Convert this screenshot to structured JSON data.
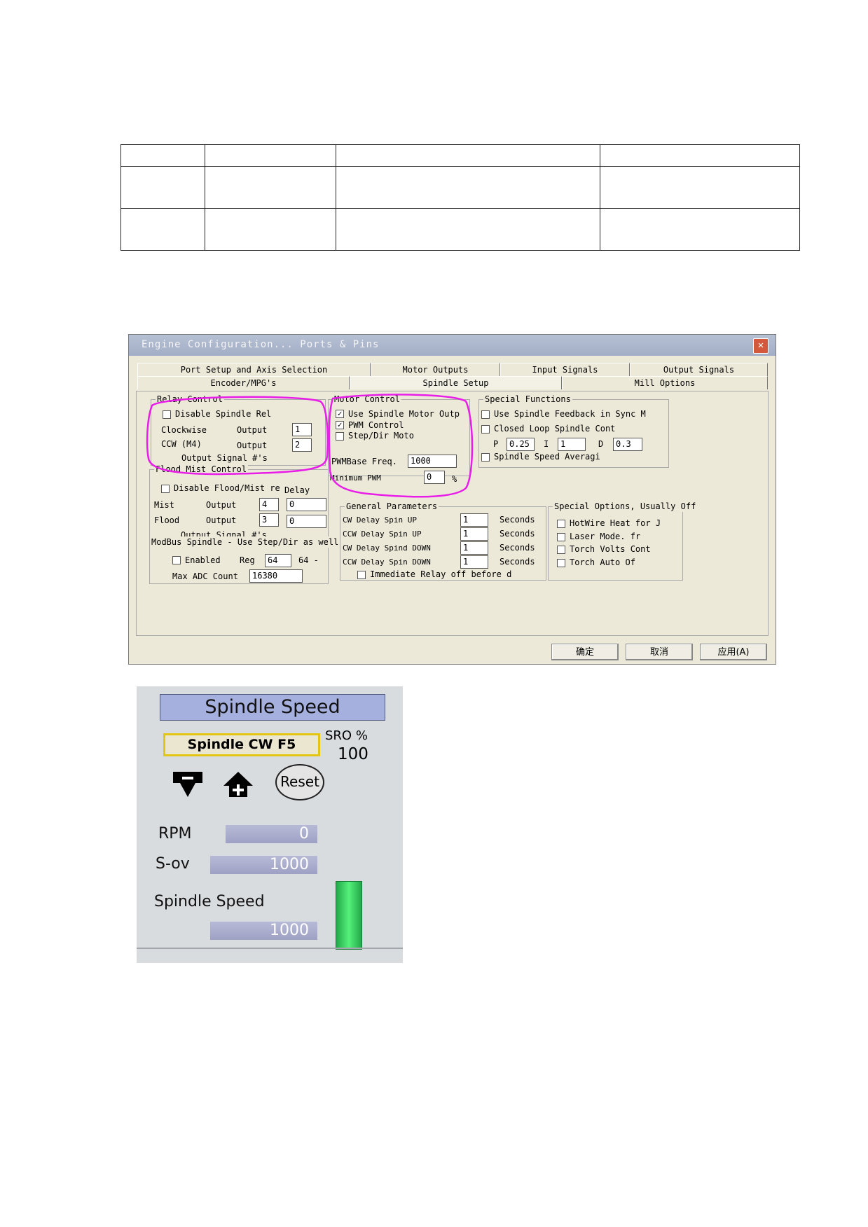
{
  "dialog": {
    "title": "Engine Configuration... Ports & Pins",
    "tabs_top": [
      "Port Setup and Axis Selection",
      "Motor Outputs",
      "Input Signals",
      "Output Signals"
    ],
    "tabs_bottom": [
      "Encoder/MPG's",
      "Spindle Setup",
      "Mill Options"
    ],
    "active_tab": "Spindle Setup",
    "relay": {
      "title": "Relay Control",
      "disable_label": "Disable Spindle Rel",
      "cw_label": "Clockwise",
      "ccw_label": "CCW (M4)",
      "output_label": "Output",
      "cw_output": "1",
      "ccw_output": "2",
      "signal_note": "Output Signal #'s"
    },
    "motor": {
      "title": "Motor Control",
      "use_spindle": "Use Spindle Motor Outp",
      "pwm": "PWM Control",
      "stepdir": "Step/Dir Moto",
      "pwm_freq_label": "PWMBase Freq.",
      "pwm_freq": "1000",
      "min_pwm_label": "Minimum PWM",
      "min_pwm": "0",
      "pct": "%"
    },
    "special": {
      "title": "Special Functions",
      "feedback": "Use Spindle Feedback in Sync M",
      "closed_loop": "Closed Loop Spindle Cont",
      "p_label": "P",
      "p": "0.25",
      "i_label": "I",
      "i": "1",
      "d_label": "D",
      "d": "0.3",
      "averaging": "Spindle Speed Averagi"
    },
    "flood": {
      "title": "Flood Mist Control",
      "disable_label": "Disable Flood/Mist re",
      "delay_label": "Delay",
      "mist_label": "Mist",
      "flood_label": "Flood",
      "output_label": "Output",
      "mist_output": "4",
      "mist_delay": "0",
      "flood_output": "3",
      "flood_delay": "0",
      "signal_note": "Output Signal #'s"
    },
    "modbus": {
      "title": "ModBus Spindle - Use Step/Dir as well",
      "enabled_label": "Enabled",
      "reg_label": "Reg",
      "reg": "64",
      "reg_suffix": "64 -",
      "max_adc_label": "Max ADC Count",
      "max_adc": "16380"
    },
    "general": {
      "title": "General Parameters",
      "rows": [
        {
          "label": "CW Delay Spin UP",
          "value": "1",
          "unit": "Seconds"
        },
        {
          "label": "CCW Delay Spin UP",
          "value": "1",
          "unit": "Seconds"
        },
        {
          "label": "CW Delay Spind DOWN",
          "value": "1",
          "unit": "Seconds"
        },
        {
          "label": "CCW Delay Spin DOWN",
          "value": "1",
          "unit": "Seconds"
        }
      ],
      "immediate": "Immediate Relay off before d"
    },
    "options": {
      "title": "Special Options, Usually Off",
      "items": [
        "HotWire Heat for J",
        "Laser Mode. fr",
        "Torch Volts Cont",
        "Torch Auto Of"
      ]
    },
    "buttons": {
      "ok": "确定",
      "cancel": "取消",
      "apply": "应用(A)"
    }
  },
  "spindle": {
    "title": "Spindle Speed",
    "cw_button": "Spindle CW F5",
    "sro_label": "SRO %",
    "sro_value": "100",
    "reset": "Reset",
    "rpm_label": "RPM",
    "rpm": "0",
    "sov_label": "S-ov",
    "sov": "1000",
    "speed_label": "Spindle Speed",
    "speed": "1000"
  },
  "colors": {
    "highlight_ellipse": "#e81ee8",
    "speed_bar": "#3ee06a",
    "title_bg": "#a6b0df"
  }
}
